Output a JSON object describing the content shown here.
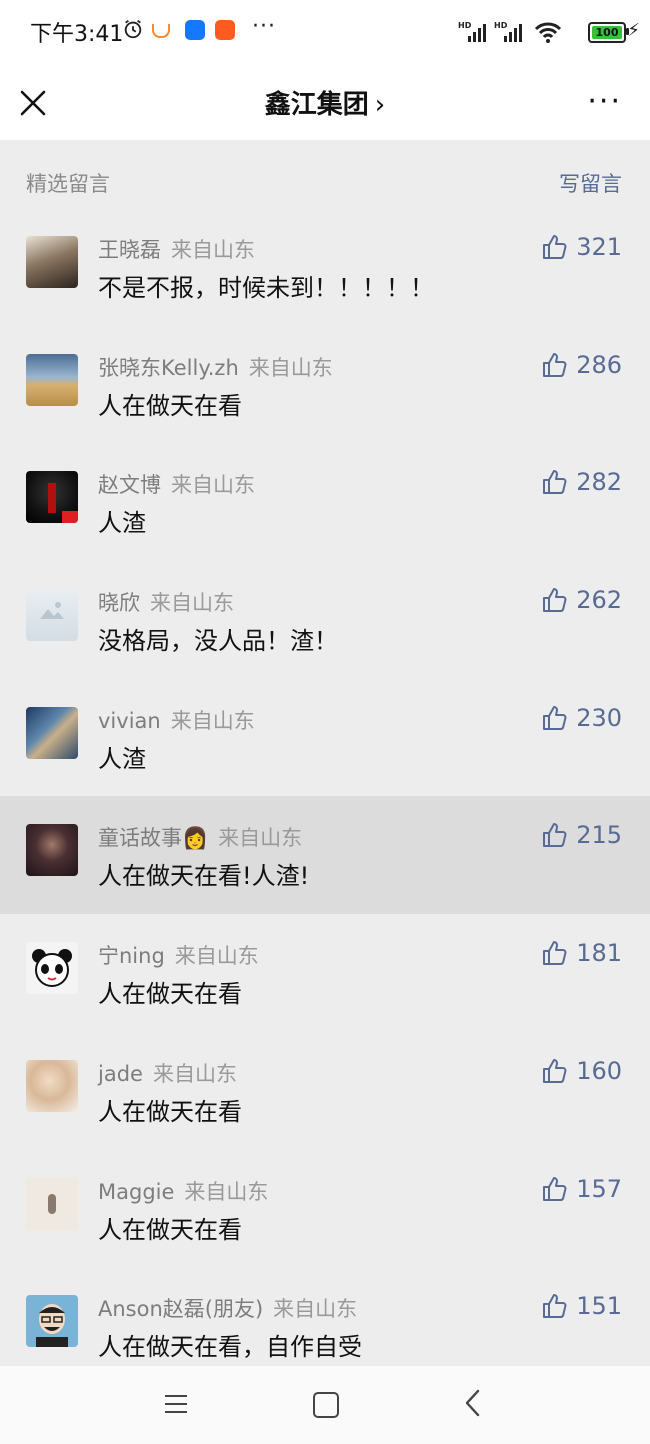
{
  "status_bar": {
    "time": "下午3:41",
    "battery": "100",
    "more": "···"
  },
  "header": {
    "title": "鑫江集团",
    "title_chevron": "›",
    "more": "···"
  },
  "section": {
    "title": "精选留言",
    "write_label": "写留言"
  },
  "comments": [
    {
      "name": "王晓磊",
      "location": "来自山东",
      "text": "不是不报，时候未到！！！！！",
      "likes": "321",
      "avatar_color": "#6b5a4a"
    },
    {
      "name": "张晓东Kelly.zh",
      "location": "来自山东",
      "text": "人在做天在看",
      "likes": "286",
      "avatar_color": "#c9a060"
    },
    {
      "name": "赵文博",
      "location": "来自山东",
      "text": "人渣",
      "likes": "282",
      "avatar_color": "#1a1a1a"
    },
    {
      "name": "晓欣",
      "location": "来自山东",
      "text": "没格局，没人品！渣！",
      "likes": "262",
      "avatar_color": "#dfe6ec"
    },
    {
      "name": "vivian",
      "location": "来自山东",
      "text": "人渣",
      "likes": "230",
      "avatar_color": "#3f5f7f"
    },
    {
      "name": "童话故事👩",
      "location": "来自山东",
      "text": "人在做天在看!人渣!",
      "likes": "215",
      "avatar_color": "#4a3540"
    },
    {
      "name": "宁ning",
      "location": "来自山东",
      "text": "人在做天在看",
      "likes": "181",
      "avatar_color": "#f2f2f2"
    },
    {
      "name": "jade",
      "location": "来自山东",
      "text": "人在做天在看",
      "likes": "160",
      "avatar_color": "#e8d6c4"
    },
    {
      "name": "Maggie",
      "location": "来自山东",
      "text": "人在做天在看",
      "likes": "157",
      "avatar_color": "#efe7df"
    },
    {
      "name": "Anson赵磊(朋友)",
      "location": "来自山东",
      "text": "人在做天在看，自作自受",
      "likes": "151",
      "avatar_color": "#6fa8c8"
    }
  ],
  "colors": {
    "link": "#576b95",
    "background": "#ededed"
  }
}
